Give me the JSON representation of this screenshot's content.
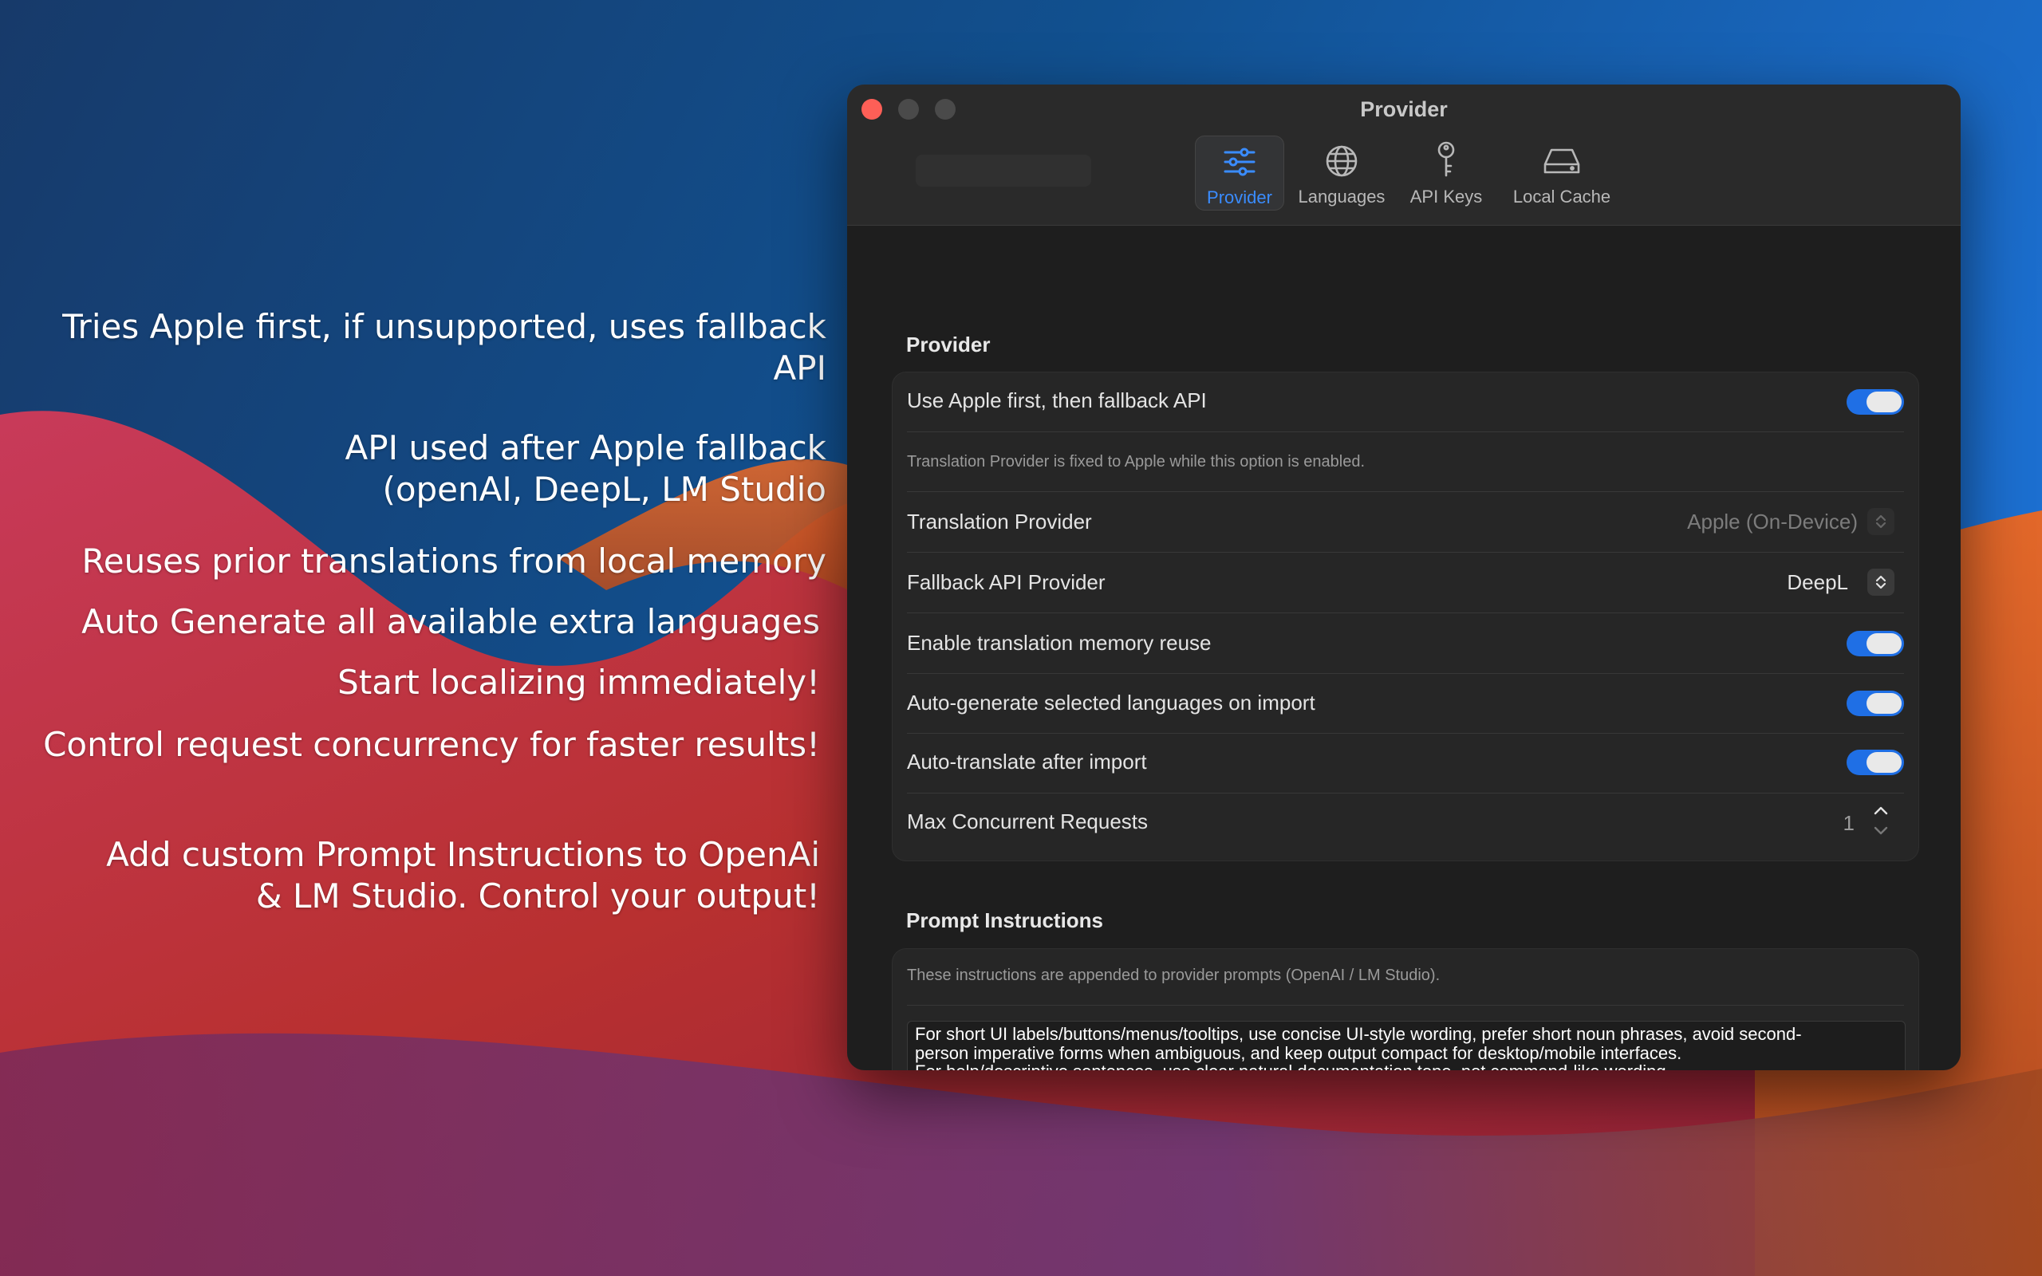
{
  "callouts": [
    "Tries Apple first, if unsupported, uses fallback API",
    "API used after Apple fallback\n(openAI, DeepL, LM Studio",
    "Reuses prior translations from local memory",
    "Auto Generate all available extra languages",
    "Start localizing immediately!",
    "Control request concurrency for faster results!",
    "Add custom Prompt Instructions to OpenAi\n& LM Studio. Control your output!"
  ],
  "window": {
    "title": "Provider"
  },
  "tabs": [
    {
      "label": "Provider",
      "icon": "sliders-icon",
      "active": true
    },
    {
      "label": "Languages",
      "icon": "globe-icon",
      "active": false
    },
    {
      "label": "API Keys",
      "icon": "key-icon",
      "active": false
    },
    {
      "label": "Local Cache",
      "icon": "drive-icon",
      "active": false
    }
  ],
  "provider_section": {
    "title": "Provider",
    "use_apple_first": {
      "label": "Use Apple first, then fallback API",
      "on": true
    },
    "note": "Translation Provider is fixed to Apple while this option is enabled.",
    "translation_provider": {
      "label": "Translation Provider",
      "value": "Apple (On-Device)",
      "disabled": true
    },
    "fallback_provider": {
      "label": "Fallback API Provider",
      "value": "DeepL"
    },
    "memory_reuse": {
      "label": "Enable translation memory reuse",
      "on": true
    },
    "auto_generate": {
      "label": "Auto-generate selected languages on import",
      "on": true
    },
    "auto_translate": {
      "label": "Auto-translate after import",
      "on": true
    },
    "max_concurrent": {
      "label": "Max Concurrent Requests",
      "value": "1"
    }
  },
  "prompt_section": {
    "title": "Prompt Instructions",
    "note": "These instructions are appended to provider prompts (OpenAI / LM Studio).",
    "text": "For short UI labels/buttons/menus/tooltips, use concise UI-style wording, prefer short noun phrases, avoid second-\nperson imperative forms when ambiguous, and keep output compact for desktop/mobile interfaces.\nFor help/descriptive sentences, use clear natural documentation tone, not command-like wording.\nKeep product names and technical tokens unchanged."
  },
  "colors": {
    "accent": "#3a8cff",
    "toggle_on": "#1f6fe5",
    "close": "#fe5f57"
  }
}
